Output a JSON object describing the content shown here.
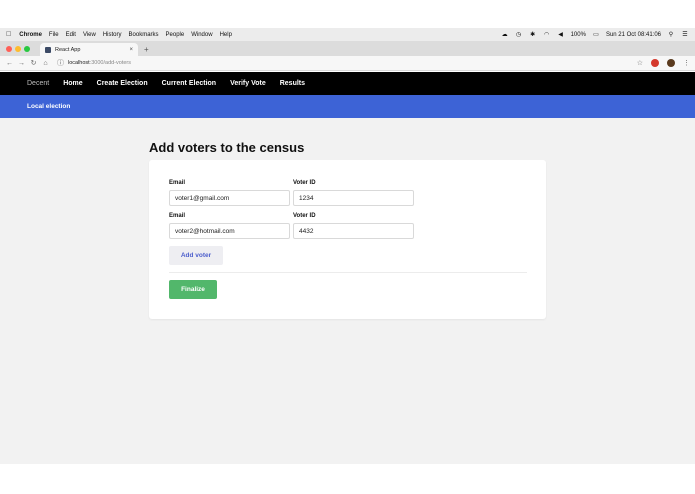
{
  "menubar": {
    "app_name": "Chrome",
    "items": [
      "File",
      "Edit",
      "View",
      "History",
      "Bookmarks",
      "People",
      "Window",
      "Help"
    ],
    "battery": "100%",
    "datetime": "Sun 21 Oct  08:41:06"
  },
  "browser": {
    "tab_title": "React App",
    "url_host": "localhost",
    "url_path": ":3000/add-voters"
  },
  "navbar": {
    "brand": "Decent",
    "links": [
      "Home",
      "Create Election",
      "Current Election",
      "Verify Vote",
      "Results"
    ]
  },
  "subnav": {
    "title": "Local election"
  },
  "page": {
    "heading": "Add voters to the census",
    "voters": [
      {
        "email_label": "Email",
        "email": "voter1@gmail.com",
        "id_label": "Voter ID",
        "voter_id": "1234"
      },
      {
        "email_label": "Email",
        "email": "voter2@hotmail.com",
        "id_label": "Voter ID",
        "voter_id": "4432"
      }
    ],
    "add_button": "Add voter",
    "finalize_button": "Finalize"
  },
  "colors": {
    "navbar_bg": "#000000",
    "subnav_bg": "#3d63d6",
    "finalize_bg": "#52b76b",
    "add_text": "#4d5fcc"
  }
}
